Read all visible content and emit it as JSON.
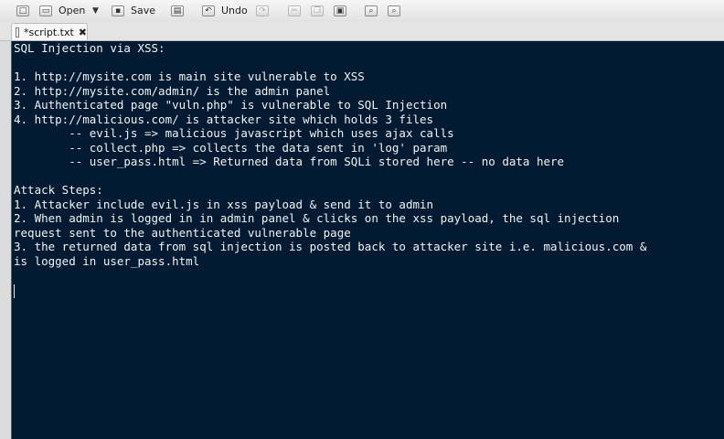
{
  "toolbar": {
    "open_label": "Open",
    "save_label": "Save",
    "undo_label": "Undo"
  },
  "tab": {
    "title": "*script.txt",
    "close": "✖"
  },
  "lines": [
    "SQL Injection via XSS:",
    "",
    "1. http://mysite.com is main site vulnerable to XSS",
    "2. http://mysite.com/admin/ is the admin panel",
    "3. Authenticated page \"vuln.php\" is vulnerable to SQL Injection",
    "4. http://malicious.com/ is attacker site which holds 3 files",
    "        -- evil.js => malicious javascript which uses ajax calls",
    "        -- collect.php => collects the data sent in 'log' param",
    "        -- user_pass.html => Returned data from SQLi stored here -- no data here",
    "",
    "Attack Steps:",
    "1. Attacker include evil.js in xss payload & send it to admin",
    "2. When admin is logged in in admin panel & clicks on the xss payload, the sql injection",
    "request sent to the authenticated vulnerable page",
    "3. the returned data from sql injection is posted back to attacker site i.e. malicious.com &",
    "is logged in user_pass.html"
  ]
}
